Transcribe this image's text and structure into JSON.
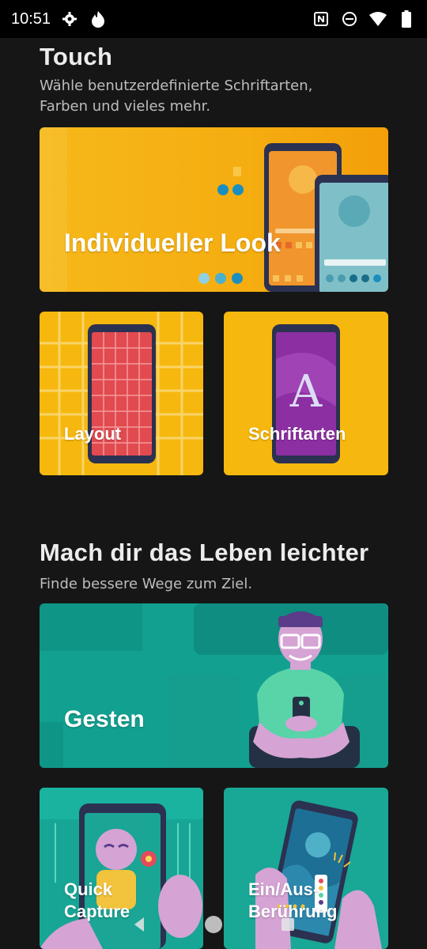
{
  "status_bar": {
    "time": "10:51"
  },
  "section1": {
    "title": "Touch",
    "subtitle_line1": "Wähle benutzerdefinierte Schriftarten,",
    "subtitle_line2": "Farben und vieles mehr.",
    "cards": {
      "look": "Individueller Look",
      "layout": "Layout",
      "fonts": "Schriftarten"
    }
  },
  "section2": {
    "title": "Mach dir das Leben leichter",
    "subtitle": "Finde bessere Wege zum Ziel.",
    "cards": {
      "gestures": "Gesten",
      "quick_capture_line1": "Quick",
      "quick_capture_line2": "Capture",
      "on_off_line1": "Ein/Aus-",
      "on_off_line2": "Berührung"
    }
  },
  "colors": {
    "yellow": "#f5b800",
    "teal": "#16a596",
    "background": "#161616"
  }
}
